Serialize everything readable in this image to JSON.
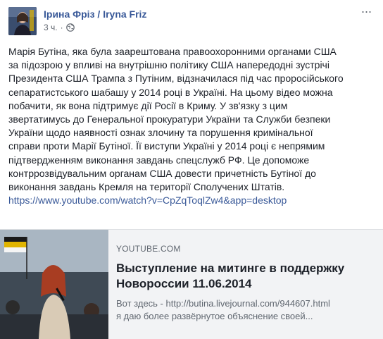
{
  "post": {
    "author": "Ірина Фріз / Iryna Friz",
    "timestamp": "3 ч.",
    "separator": "·",
    "privacy_icon": "globe-icon",
    "more_icon": "ellipsis-icon",
    "more_label": "···",
    "text_lines": [
      "Марія Бутіна, яка була заарештована правоохоронними органами США",
      "за підозрою у впливі на внутрішню політику США напередодні зустрічі",
      "Президента США Трампа з Путіним, відзначилася під час проросійського",
      "сепаратистського шабашу у 2014 році в Україні. На цьому відео можна",
      "побачити, як вона підтримує дії Росії в Криму. У зв'язку з цим",
      "звертатимусь до Генеральної прокуратури України та Служби безпеки",
      "України щодо наявності ознак злочину та порушення кримінальної",
      "справи проти Марії Бутіної. Її виступи Україні у 2014 році є непрямим",
      "підтвердженням виконання завдань спецслужб РФ. Це допоможе",
      "контррозвідувальним органам США довести причетність Бутіної до",
      "виконання завдань Кремля на території Сполучених Штатів."
    ],
    "link": "https://www.youtube.com/watch?v=CpZqToqlZw4&app=desktop"
  },
  "preview": {
    "domain": "YOUTUBE.COM",
    "title_lines": [
      "Выступление на митинге в поддержку",
      "Новороссии 11.06.2014"
    ],
    "desc_lines": [
      "Вот здесь - http://butina.livejournal.com/944607.html",
      "я даю более развёрнутое объяснение своей..."
    ]
  },
  "colors": {
    "link": "#385898",
    "text": "#1d2129",
    "muted": "#606770",
    "preview_bg": "#f2f3f5"
  }
}
